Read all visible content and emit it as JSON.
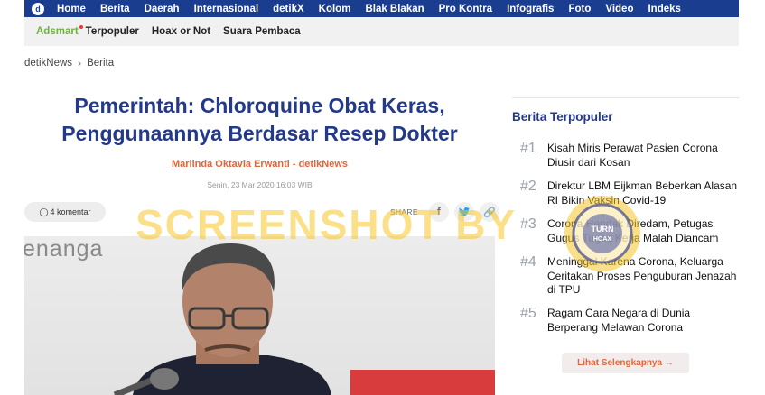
{
  "topnav": {
    "logo": "d",
    "items": [
      "Home",
      "Berita",
      "Daerah",
      "Internasional",
      "detikX",
      "Kolom",
      "Blak Blakan",
      "Pro Kontra",
      "Infografis",
      "Foto",
      "Video",
      "Indeks"
    ]
  },
  "subnav": {
    "adsmart": "Adsmart",
    "items": [
      "Terpopuler",
      "Hoax or Not",
      "Suara Pembaca"
    ]
  },
  "breadcrumb": {
    "site": "detikNews",
    "section": "Berita"
  },
  "article": {
    "title": "Pemerintah: Chloroquine Obat Keras, Penggunaannya Berdasar Resep Dokter",
    "author": "Marlinda Oktavia Erwanti - detikNews",
    "date": "Senin, 23 Mar 2020 16:03 WIB",
    "comments": "4 komentar",
    "share_label": "SHARE",
    "photo_text": "enanga"
  },
  "sidebar": {
    "title": "Berita Terpopuler",
    "items": [
      {
        "num": "#1",
        "text": "Kisah Miris Perawat Pasien Corona Diusir dari Kosan"
      },
      {
        "num": "#2",
        "text": "Direktur LBM Eijkman Beberkan Alasan RI Bikin Vaksin Covid-19"
      },
      {
        "num": "#3",
        "text": "Corona Hendak Diredam, Petugas Gugus Tugas Kerja Malah Diancam"
      },
      {
        "num": "#4",
        "text": "Meninggal Karena Corona, Keluarga Ceritakan Proses Penguburan Jenazah di TPU"
      },
      {
        "num": "#5",
        "text": "Ragam Cara Negara di Dunia Berperang Melawan Corona"
      }
    ],
    "more_label": "Lihat Selengkapnya →"
  },
  "watermark": {
    "text": "SCREENSHOT BY",
    "seal": "TURN BACK HOAX"
  }
}
